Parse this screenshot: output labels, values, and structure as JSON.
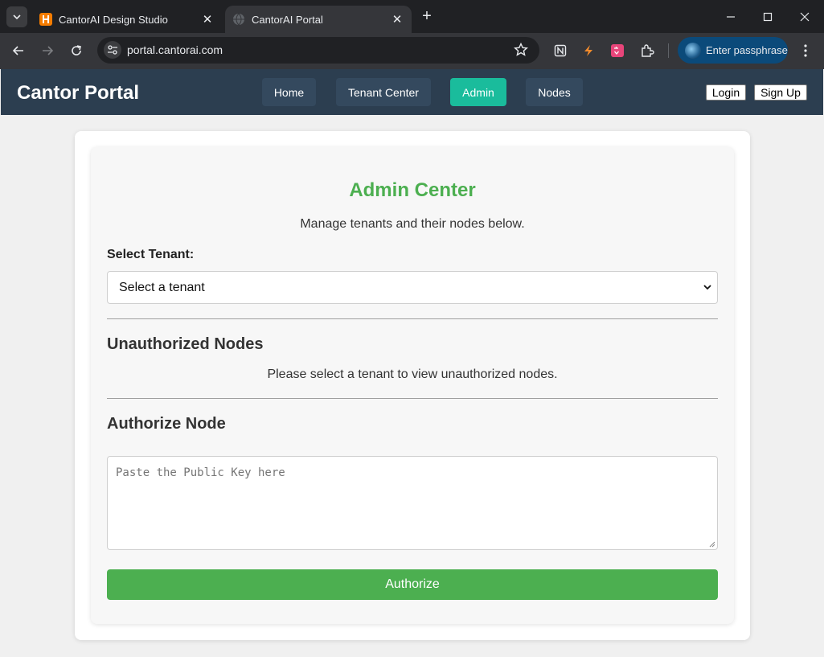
{
  "browser": {
    "tabs": [
      {
        "title": "CantorAI Design Studio",
        "active": false
      },
      {
        "title": "CantorAI Portal",
        "active": true
      }
    ],
    "url": "portal.cantorai.com",
    "profile_label": "Enter passphrase"
  },
  "navbar": {
    "brand": "Cantor Portal",
    "links": [
      {
        "label": "Home",
        "active": false
      },
      {
        "label": "Tenant Center",
        "active": false
      },
      {
        "label": "Admin",
        "active": true
      },
      {
        "label": "Nodes",
        "active": false
      }
    ],
    "login_label": "Login",
    "signup_label": "Sign Up"
  },
  "admin": {
    "title": "Admin Center",
    "subtitle": "Manage tenants and their nodes below.",
    "tenant_label": "Select Tenant:",
    "tenant_selected": "Select a tenant",
    "unauthorized_heading": "Unauthorized Nodes",
    "unauthorized_message": "Please select a tenant to view unauthorized nodes.",
    "authorize_heading": "Authorize Node",
    "public_key_placeholder": "Paste the Public Key here",
    "authorize_button": "Authorize"
  },
  "colors": {
    "navbar_bg": "#2c3e50",
    "nav_link_bg": "#34495e",
    "nav_active_bg": "#1abc9c",
    "accent_green": "#4caf50"
  }
}
